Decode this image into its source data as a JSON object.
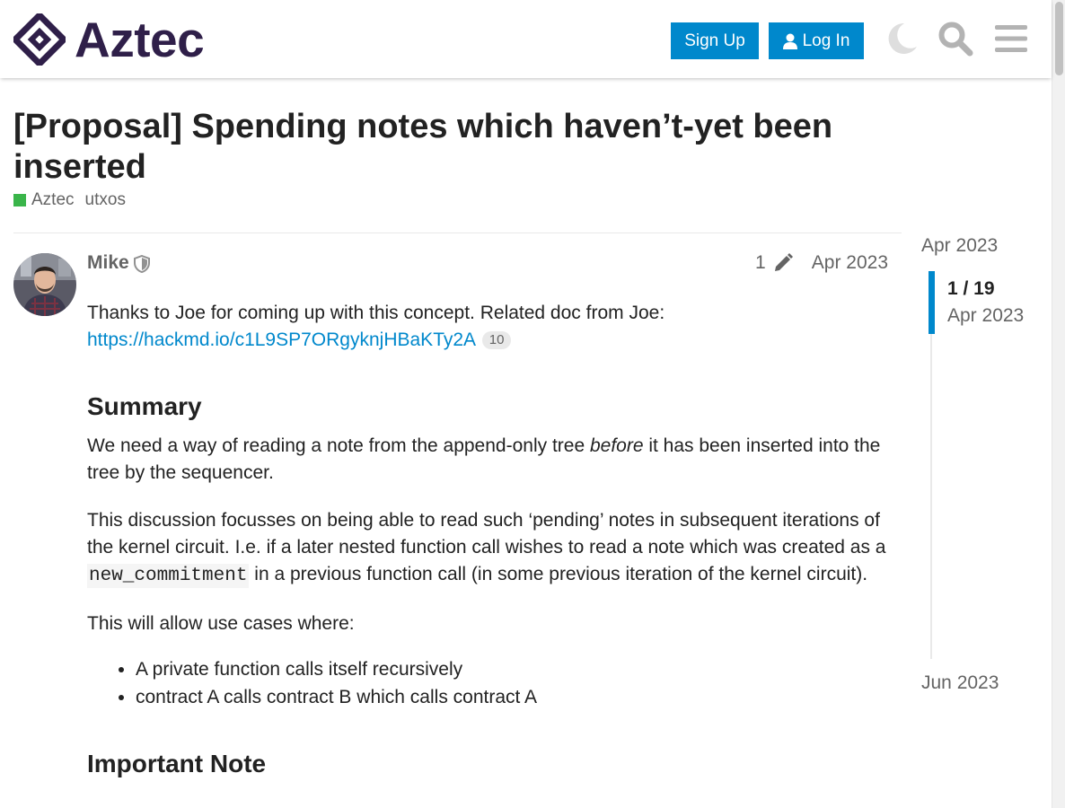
{
  "header": {
    "logo_text": "Aztec",
    "signup_label": "Sign Up",
    "login_label": "Log In",
    "icons": [
      "theme-toggle-moon-icon",
      "search-icon",
      "hamburger-menu-icon"
    ],
    "brand_color": "#2f1f49",
    "accent_color": "#0088cc"
  },
  "topic": {
    "title": "[Proposal] Spending notes which haven’t-yet been inserted",
    "category": "Aztec",
    "category_color": "#3ab54a",
    "tag": "utxos"
  },
  "post": {
    "author": "Mike",
    "edit_count": "1",
    "date": "Apr 2023",
    "intro": "Thanks to Joe for coming up with this concept. Related doc from Joe:",
    "link_text": "https://hackmd.io/c1L9SP7ORgyknjHBaKTy2A",
    "link_clicks": "10",
    "summary_heading": "Summary",
    "p_summary_a": "We need a way of reading a note from the append-only tree ",
    "p_summary_em": "before",
    "p_summary_b": " it has been inserted into the tree by the sequencer.",
    "p_discussion_a": "This discussion focusses on being able to read such ‘pending’ notes in subsequent iterations of the kernel circuit. I.e. if a later nested function call wishes to read a note which was created as a ",
    "p_discussion_code": "new_commitment",
    "p_discussion_b": " in a previous function call (in some previous iteration of the kernel circuit).",
    "p_usecases": "This will allow use cases where:",
    "list_items": [
      "A private function calls itself recursively",
      "contract A calls contract B which calls contract A"
    ],
    "important_heading": "Important Note"
  },
  "timeline": {
    "start_date": "Apr 2023",
    "position": "1 / 19",
    "position_date": "Apr 2023",
    "end_date": "Jun 2023"
  }
}
